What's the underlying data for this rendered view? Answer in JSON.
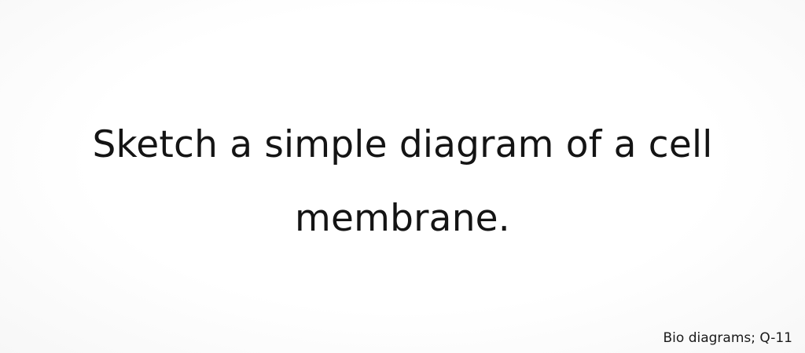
{
  "question": {
    "line1": "Sketch a simple diagram of a cell",
    "line2": "membrane."
  },
  "footer": {
    "label": "Bio diagrams; Q-11"
  }
}
